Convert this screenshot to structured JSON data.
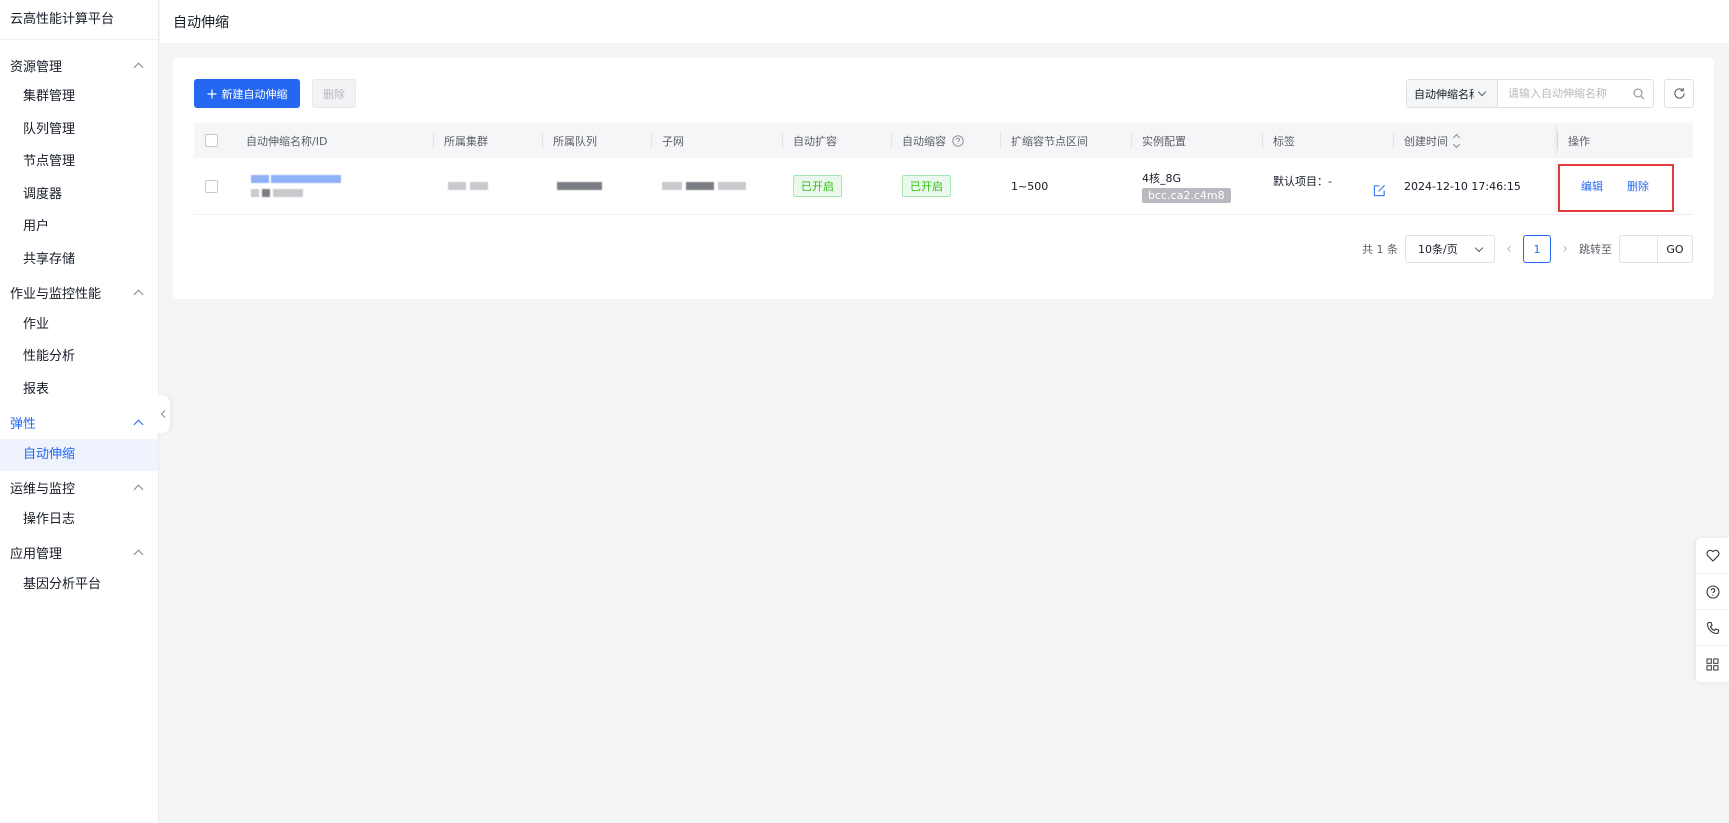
{
  "app": {
    "title": "云高性能计算平台"
  },
  "sidebar": {
    "groups": [
      {
        "label": "资源管理",
        "items": [
          "集群管理",
          "队列管理",
          "节点管理",
          "调度器",
          "用户",
          "共享存储"
        ]
      },
      {
        "label": "作业与监控性能",
        "items": [
          "作业",
          "性能分析",
          "报表"
        ]
      },
      {
        "label": "弹性",
        "items": [
          "自动伸缩"
        ]
      },
      {
        "label": "运维与监控",
        "items": [
          "操作日志"
        ]
      },
      {
        "label": "应用管理",
        "items": [
          "基因分析平台"
        ]
      }
    ],
    "active_item": "自动伸缩"
  },
  "header": {
    "title": "自动伸缩"
  },
  "toolbar": {
    "create_label": "新建自动伸缩",
    "delete_label": "删除",
    "search_field": "自动伸缩名称",
    "search_placeholder": "请输入自动伸缩名称"
  },
  "table": {
    "columns": [
      "自动伸缩名称/ID",
      "所属集群",
      "所属队列",
      "子网",
      "自动扩容",
      "自动缩容",
      "扩缩容节点区间",
      "实例配置",
      "标签",
      "创建时间",
      "操作"
    ],
    "rows": [
      {
        "scale_out": "已开启",
        "scale_in": "已开启",
        "node_range": "1~500",
        "spec": "4核_8G",
        "instance_type": "bcc.ca2.c4m8",
        "tag": "默认项目：-",
        "created": "2024-12-10 17:46:15",
        "actions": {
          "edit": "编辑",
          "delete": "删除"
        }
      }
    ]
  },
  "pagination": {
    "total": "共 1 条",
    "page_size": "10条/页",
    "current_page": "1",
    "jump_label": "跳转至",
    "go_label": "GO"
  },
  "colors": {
    "primary": "#2468f2",
    "success": "#30bf13",
    "highlight": "#e43c3c"
  }
}
